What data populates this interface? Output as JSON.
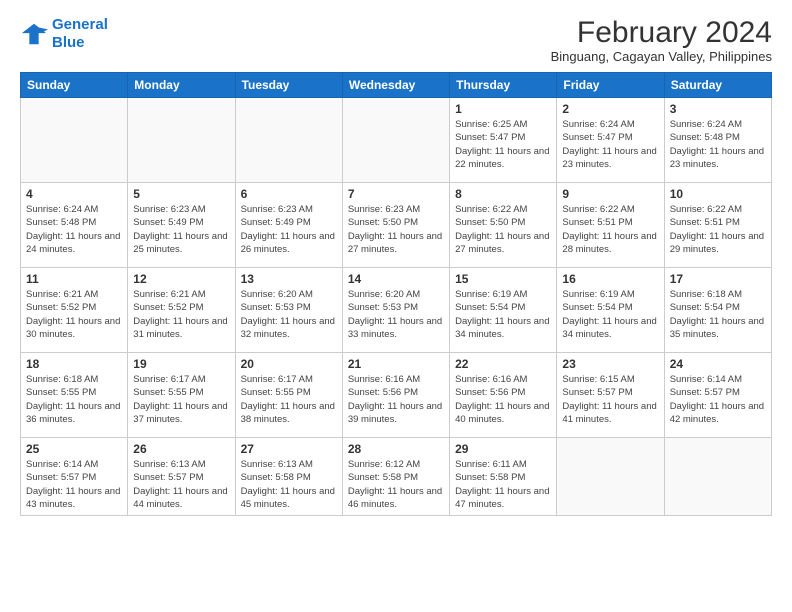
{
  "header": {
    "logo_line1": "General",
    "logo_line2": "Blue",
    "month_year": "February 2024",
    "location": "Binguang, Cagayan Valley, Philippines"
  },
  "days_of_week": [
    "Sunday",
    "Monday",
    "Tuesday",
    "Wednesday",
    "Thursday",
    "Friday",
    "Saturday"
  ],
  "weeks": [
    [
      {
        "day": "",
        "info": ""
      },
      {
        "day": "",
        "info": ""
      },
      {
        "day": "",
        "info": ""
      },
      {
        "day": "",
        "info": ""
      },
      {
        "day": "1",
        "info": "Sunrise: 6:25 AM\nSunset: 5:47 PM\nDaylight: 11 hours and 22 minutes."
      },
      {
        "day": "2",
        "info": "Sunrise: 6:24 AM\nSunset: 5:47 PM\nDaylight: 11 hours and 23 minutes."
      },
      {
        "day": "3",
        "info": "Sunrise: 6:24 AM\nSunset: 5:48 PM\nDaylight: 11 hours and 23 minutes."
      }
    ],
    [
      {
        "day": "4",
        "info": "Sunrise: 6:24 AM\nSunset: 5:48 PM\nDaylight: 11 hours and 24 minutes."
      },
      {
        "day": "5",
        "info": "Sunrise: 6:23 AM\nSunset: 5:49 PM\nDaylight: 11 hours and 25 minutes."
      },
      {
        "day": "6",
        "info": "Sunrise: 6:23 AM\nSunset: 5:49 PM\nDaylight: 11 hours and 26 minutes."
      },
      {
        "day": "7",
        "info": "Sunrise: 6:23 AM\nSunset: 5:50 PM\nDaylight: 11 hours and 27 minutes."
      },
      {
        "day": "8",
        "info": "Sunrise: 6:22 AM\nSunset: 5:50 PM\nDaylight: 11 hours and 27 minutes."
      },
      {
        "day": "9",
        "info": "Sunrise: 6:22 AM\nSunset: 5:51 PM\nDaylight: 11 hours and 28 minutes."
      },
      {
        "day": "10",
        "info": "Sunrise: 6:22 AM\nSunset: 5:51 PM\nDaylight: 11 hours and 29 minutes."
      }
    ],
    [
      {
        "day": "11",
        "info": "Sunrise: 6:21 AM\nSunset: 5:52 PM\nDaylight: 11 hours and 30 minutes."
      },
      {
        "day": "12",
        "info": "Sunrise: 6:21 AM\nSunset: 5:52 PM\nDaylight: 11 hours and 31 minutes."
      },
      {
        "day": "13",
        "info": "Sunrise: 6:20 AM\nSunset: 5:53 PM\nDaylight: 11 hours and 32 minutes."
      },
      {
        "day": "14",
        "info": "Sunrise: 6:20 AM\nSunset: 5:53 PM\nDaylight: 11 hours and 33 minutes."
      },
      {
        "day": "15",
        "info": "Sunrise: 6:19 AM\nSunset: 5:54 PM\nDaylight: 11 hours and 34 minutes."
      },
      {
        "day": "16",
        "info": "Sunrise: 6:19 AM\nSunset: 5:54 PM\nDaylight: 11 hours and 34 minutes."
      },
      {
        "day": "17",
        "info": "Sunrise: 6:18 AM\nSunset: 5:54 PM\nDaylight: 11 hours and 35 minutes."
      }
    ],
    [
      {
        "day": "18",
        "info": "Sunrise: 6:18 AM\nSunset: 5:55 PM\nDaylight: 11 hours and 36 minutes."
      },
      {
        "day": "19",
        "info": "Sunrise: 6:17 AM\nSunset: 5:55 PM\nDaylight: 11 hours and 37 minutes."
      },
      {
        "day": "20",
        "info": "Sunrise: 6:17 AM\nSunset: 5:55 PM\nDaylight: 11 hours and 38 minutes."
      },
      {
        "day": "21",
        "info": "Sunrise: 6:16 AM\nSunset: 5:56 PM\nDaylight: 11 hours and 39 minutes."
      },
      {
        "day": "22",
        "info": "Sunrise: 6:16 AM\nSunset: 5:56 PM\nDaylight: 11 hours and 40 minutes."
      },
      {
        "day": "23",
        "info": "Sunrise: 6:15 AM\nSunset: 5:57 PM\nDaylight: 11 hours and 41 minutes."
      },
      {
        "day": "24",
        "info": "Sunrise: 6:14 AM\nSunset: 5:57 PM\nDaylight: 11 hours and 42 minutes."
      }
    ],
    [
      {
        "day": "25",
        "info": "Sunrise: 6:14 AM\nSunset: 5:57 PM\nDaylight: 11 hours and 43 minutes."
      },
      {
        "day": "26",
        "info": "Sunrise: 6:13 AM\nSunset: 5:57 PM\nDaylight: 11 hours and 44 minutes."
      },
      {
        "day": "27",
        "info": "Sunrise: 6:13 AM\nSunset: 5:58 PM\nDaylight: 11 hours and 45 minutes."
      },
      {
        "day": "28",
        "info": "Sunrise: 6:12 AM\nSunset: 5:58 PM\nDaylight: 11 hours and 46 minutes."
      },
      {
        "day": "29",
        "info": "Sunrise: 6:11 AM\nSunset: 5:58 PM\nDaylight: 11 hours and 47 minutes."
      },
      {
        "day": "",
        "info": ""
      },
      {
        "day": "",
        "info": ""
      }
    ]
  ]
}
